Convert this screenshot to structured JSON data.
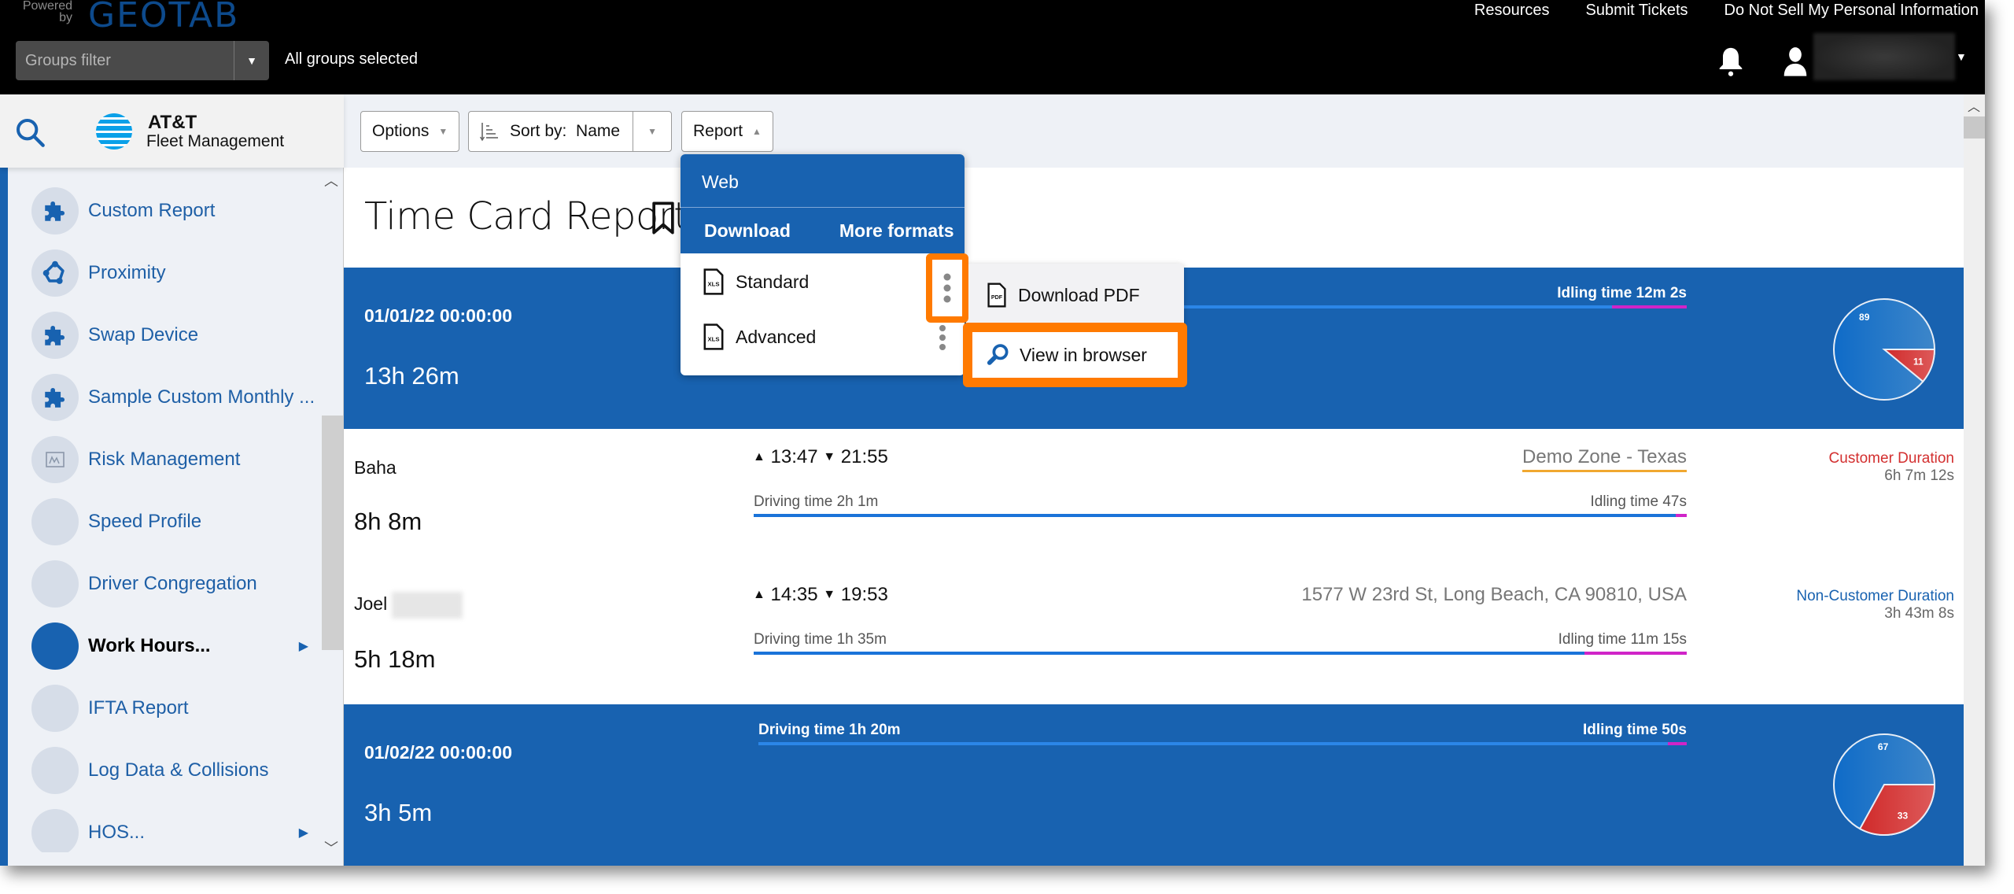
{
  "header": {
    "powered_by": "Powered by",
    "brand": "GEOTAB",
    "groups_filter_placeholder": "Groups filter",
    "groups_status": "All groups selected",
    "links": [
      "Resources",
      "Submit Tickets",
      "Do Not Sell My Personal Information"
    ],
    "icons": {
      "notifications": "bell-icon",
      "user": "user-icon"
    }
  },
  "sidebar": {
    "logo_line1": "AT&T",
    "logo_line2": "Fleet Management",
    "items": [
      {
        "label": "Custom Report",
        "icon": "puzzle-icon"
      },
      {
        "label": "Proximity",
        "icon": "proximity-icon"
      },
      {
        "label": "Swap Device",
        "icon": "puzzle-icon"
      },
      {
        "label": "Sample Custom Monthly ...",
        "icon": "puzzle-icon"
      },
      {
        "label": "Risk Management",
        "icon": "chart-icon"
      },
      {
        "label": "Speed Profile",
        "icon": ""
      },
      {
        "label": "Driver Congregation",
        "icon": ""
      },
      {
        "label": "Work Hours...",
        "icon": "",
        "active": true,
        "submenu": true
      },
      {
        "label": "IFTA Report",
        "icon": ""
      },
      {
        "label": "Log Data & Collisions",
        "icon": ""
      },
      {
        "label": "HOS...",
        "icon": "",
        "submenu": true
      }
    ]
  },
  "toolbar": {
    "options_label": "Options",
    "sort_prefix": "Sort by:",
    "sort_value": "Name",
    "report_label": "Report"
  },
  "page": {
    "title": "Time Card Report"
  },
  "report_menu": {
    "web_label": "Web",
    "tab_download": "Download",
    "tab_more_formats": "More formats",
    "options": [
      "Standard",
      "Advanced"
    ],
    "submenu": [
      "Download PDF",
      "View in browser"
    ]
  },
  "days": [
    {
      "date": "01/01/22 00:00:00",
      "total": "13h 26m",
      "driving_label": "",
      "idling_label": "Idling time 12m 2s",
      "idle_fraction": 0.08,
      "pie": {
        "customer": 11,
        "non_customer": 89
      },
      "drivers": [
        {
          "name": "Baha",
          "duration": "8h 8m",
          "start": "13:47",
          "end": "21:55",
          "location": "Demo Zone - Texas",
          "zone": true,
          "driving_label": "Driving time 2h 1m",
          "idling_label": "Idling time 47s",
          "idle_fraction": 0.01,
          "duration_type": "Customer Duration",
          "duration_value": "6h 7m 12s"
        },
        {
          "name": "Joel",
          "duration": "5h 18m",
          "start": "14:35",
          "end": "19:53",
          "location": "1577 W 23rd St, Long Beach, CA 90810, USA",
          "zone": false,
          "driving_label": "Driving time 1h 35m",
          "idling_label": "Idling time 11m 15s",
          "idle_fraction": 0.11,
          "duration_type": "Non-Customer Duration",
          "duration_value": "3h 43m 8s"
        }
      ]
    },
    {
      "date": "01/02/22 00:00:00",
      "total": "3h 5m",
      "driving_label": "Driving time 1h 20m",
      "idling_label": "Idling time 50s",
      "idle_fraction": 0.02,
      "pie": {
        "customer": 33,
        "non_customer": 67
      }
    }
  ],
  "colors": {
    "brand_blue": "#1862b0",
    "highlight_orange": "#ff7a00",
    "idle_magenta": "#d024c8",
    "zone_underline": "#f0a830",
    "customer_red": "#d32f2f"
  }
}
